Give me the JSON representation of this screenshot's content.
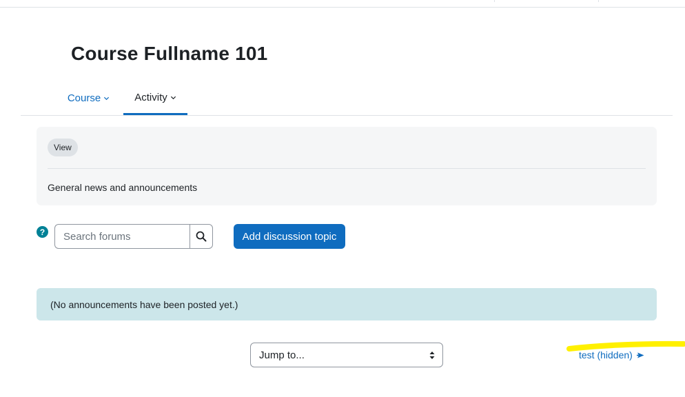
{
  "header": {
    "title": "Course Fullname 101"
  },
  "tabs": [
    {
      "label": "Course",
      "active": false
    },
    {
      "label": "Activity",
      "active": true
    }
  ],
  "info_panel": {
    "view_badge": "View",
    "description": "General news and announcements"
  },
  "toolbar": {
    "help_label": "?",
    "search_placeholder": "Search forums",
    "add_button_label": "Add discussion topic"
  },
  "notice": {
    "text": "(No announcements have been posted yet.)"
  },
  "footer_nav": {
    "jump_select_value": "Jump to...",
    "next_link_label": "test (hidden)"
  },
  "icons": {
    "help": "question-circle-icon",
    "search": "search-icon",
    "tab_chevron": "chevron-down-icon",
    "select_arrows": "select-updown-icon",
    "next": "arrow-right-icon"
  },
  "colors": {
    "brand_blue": "#0f6cbf",
    "help_teal": "#008196",
    "info_alert_bg": "#cce6ea",
    "panel_bg": "#f5f6f7",
    "highlight_yellow": "#fff000"
  }
}
